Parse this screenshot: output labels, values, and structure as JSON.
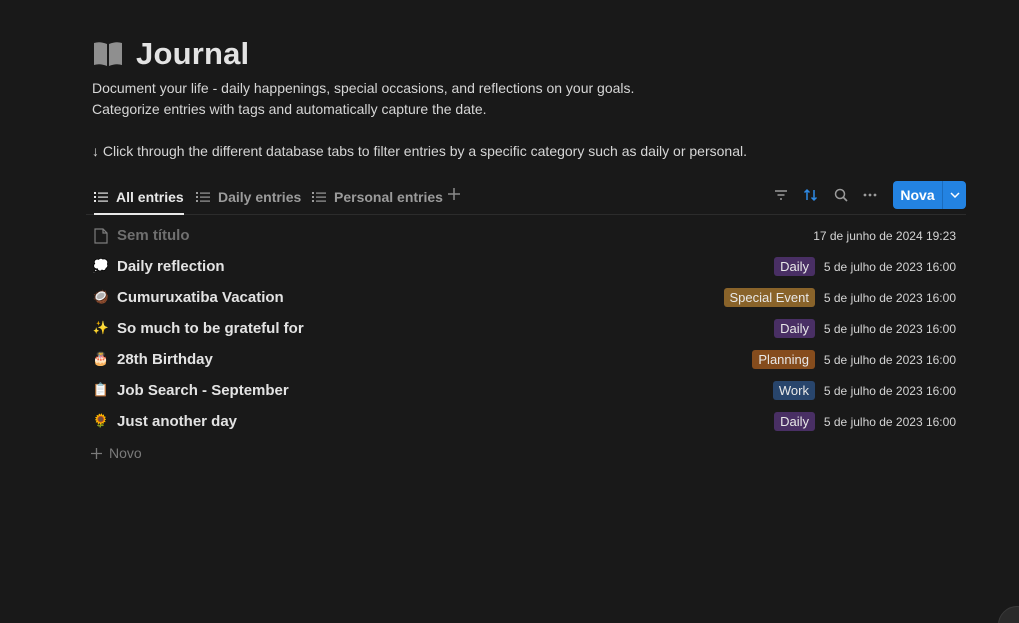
{
  "page": {
    "title": "Journal",
    "description": [
      "Document your life - daily happenings, special occasions, and reflections on your goals.",
      "Categorize entries with tags and automatically capture the date.",
      "↓ Click through the different database tabs to filter entries by a specific category such as daily or personal."
    ]
  },
  "tabs": [
    {
      "label": "All entries",
      "active": true
    },
    {
      "label": "Daily entries",
      "active": false
    },
    {
      "label": "Personal entries",
      "active": false
    }
  ],
  "toolbar": {
    "new_label": "Nova",
    "icons": [
      "filter-icon",
      "sort-icon",
      "search-icon",
      "more-icon",
      "chevron-down-icon"
    ]
  },
  "entries": [
    {
      "emoji": "",
      "icon": "page-icon",
      "name": "Sem título",
      "placeholder": true,
      "tag": "",
      "tag_color": "",
      "date": "17 de junho de 2024 19:23"
    },
    {
      "emoji": "💭",
      "icon": "thought-balloon-icon",
      "name": "Daily reflection",
      "tag": "Daily",
      "tag_color": "#492f64",
      "date": "5 de julho de 2023 16:00"
    },
    {
      "emoji": "🥥",
      "icon": "coconut-icon",
      "name": "Cumuruxatiba Vacation",
      "tag": "Special Event",
      "tag_color": "#89632a",
      "date": "5 de julho de 2023 16:00"
    },
    {
      "emoji": "✨",
      "icon": "sparkles-icon",
      "name": "So much to be grateful for",
      "tag": "Daily",
      "tag_color": "#492f64",
      "date": "5 de julho de 2023 16:00"
    },
    {
      "emoji": "🎂",
      "icon": "birthday-cake-icon",
      "name": "28th Birthday",
      "tag": "Planning",
      "tag_color": "#854c1d",
      "date": "5 de julho de 2023 16:00"
    },
    {
      "emoji": "📋",
      "icon": "clipboard-icon",
      "name": "Job Search - September",
      "tag": "Work",
      "tag_color": "#28456c",
      "date": "5 de julho de 2023 16:00"
    },
    {
      "emoji": "🌻",
      "icon": "sunflower-icon",
      "name": "Just another day",
      "tag": "Daily",
      "tag_color": "#492f64",
      "date": "5 de julho de 2023 16:00"
    }
  ],
  "add_row_label": "Novo"
}
